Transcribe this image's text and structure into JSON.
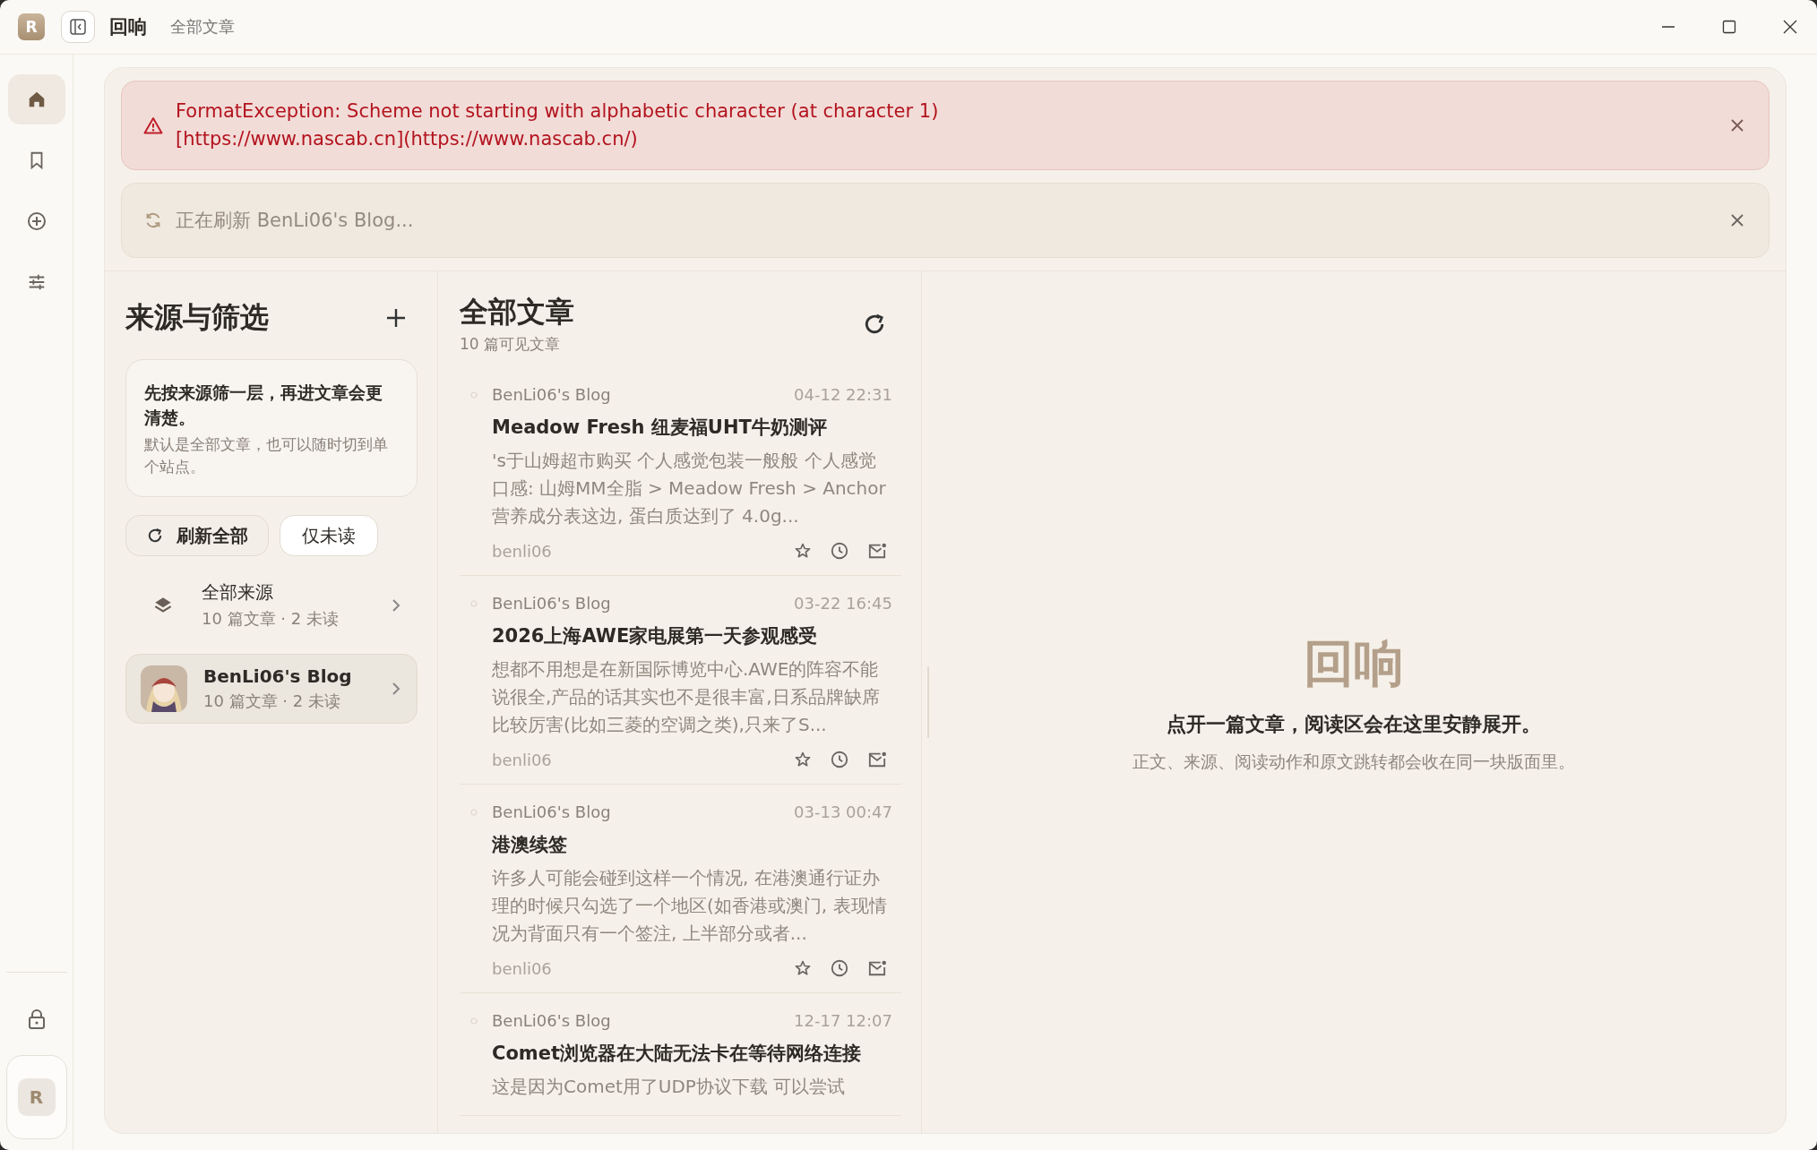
{
  "titlebar": {
    "logo": "R",
    "app_name": "回响",
    "page": "全部文章"
  },
  "rail": {
    "items": [
      {
        "kind": "home",
        "selected": true
      },
      {
        "kind": "bookmark",
        "selected": false
      },
      {
        "kind": "add",
        "selected": false
      },
      {
        "kind": "sliders",
        "selected": false
      }
    ],
    "avatar": "R"
  },
  "banners": [
    {
      "kind": "error",
      "lines": [
        "FormatException: Scheme not starting with alphabetic character (at character 1)",
        "[https://www.nascab.cn](https://www.nascab.cn/)"
      ]
    },
    {
      "kind": "progress",
      "lines": [
        "正在刷新 BenLi06's Blog..."
      ]
    }
  ],
  "sources": {
    "title": "来源与筛选",
    "tip_title": "先按来源筛一层，再进文章会更清楚。",
    "tip_body": "默认是全部文章，也可以随时切到单个站点。",
    "refresh_button": "刷新全部",
    "unread_button": "仅未读",
    "items": [
      {
        "kind": "all",
        "name": "全部来源",
        "meta": "10 篇文章 · 2 未读",
        "selected": false
      },
      {
        "kind": "feed",
        "name": "BenLi06's Blog",
        "meta": "10 篇文章 · 2 未读",
        "selected": true
      }
    ]
  },
  "articles": {
    "title": "全部文章",
    "count": "10 篇可见文章",
    "items": [
      {
        "source": "BenLi06's Blog",
        "time": "04-12 22:31",
        "title": "Meadow Fresh 纽麦福UHT牛奶测评",
        "excerpt": "'s于山姆超市购买 个人感觉包装一般般 个人感觉口感: 山姆MM全脂 > Meadow Fresh > Anchor 营养成分表这边, 蛋白质达到了 4.0g...",
        "author": "benli06"
      },
      {
        "source": "BenLi06's Blog",
        "time": "03-22 16:45",
        "title": "2026上海AWE家电展第一天参观感受",
        "excerpt": "想都不用想是在新国际博览中心.AWE的阵容不能说很全,产品的话其实也不是很丰富,日系品牌缺席比较厉害(比如三菱的空调之类),只来了S...",
        "author": "benli06"
      },
      {
        "source": "BenLi06's Blog",
        "time": "03-13 00:47",
        "title": "港澳续签",
        "excerpt": "许多人可能会碰到这样一个情况, 在港澳通行证办理的时候只勾选了一个地区(如香港或澳门, 表现情况为背面只有一个签注, 上半部分或者...",
        "author": "benli06"
      },
      {
        "source": "BenLi06's Blog",
        "time": "12-17 12:07",
        "title": "Comet浏览器在大陆无法卡在等待网络连接",
        "excerpt": "这是因为Comet用了UDP协议下载 可以尝试"
      }
    ]
  },
  "reader": {
    "logo": "回响",
    "headline": "点开一篇文章，阅读区会在这里安静展开。",
    "subline": "正文、来源、阅读动作和原文跳转都会收在同一块版面里。"
  }
}
